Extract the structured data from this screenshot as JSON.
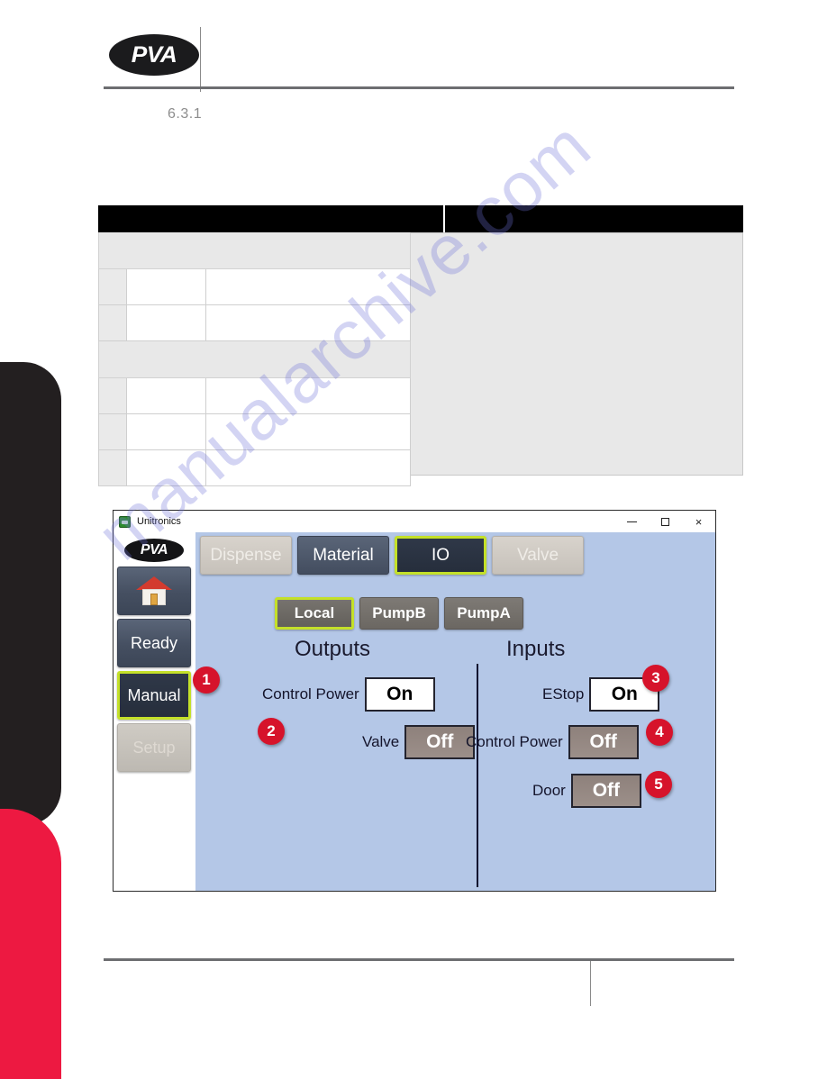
{
  "document": {
    "brand_logo_text": "PVA",
    "section_number": "6.3.1",
    "watermark": "manualarchive.com"
  },
  "table": {
    "header_left": "",
    "header_right": "",
    "group_rows": [
      "",
      ""
    ],
    "rows": [
      {
        "num": "",
        "name": "",
        "desc": ""
      },
      {
        "num": "",
        "name": "",
        "desc": ""
      },
      {
        "num": "",
        "name": "",
        "desc": ""
      },
      {
        "num": "",
        "name": "",
        "desc": ""
      },
      {
        "num": "",
        "name": "",
        "desc": ""
      }
    ]
  },
  "app": {
    "title": "Unitronics",
    "title_icon": "unitronics-icon",
    "window_controls": {
      "minimize": "minimize-icon",
      "maximize": "maximize-icon",
      "close": "×"
    },
    "logo_text": "PVA",
    "sidebar": {
      "home_icon": "house-icon",
      "items": [
        {
          "label": "Ready",
          "state": "normal"
        },
        {
          "label": "Manual",
          "state": "selected"
        },
        {
          "label": "Setup",
          "state": "disabled"
        }
      ]
    },
    "tabs": [
      {
        "label": "Dispense",
        "state": "inactive"
      },
      {
        "label": "Material",
        "state": "mid"
      },
      {
        "label": "IO",
        "state": "selected"
      },
      {
        "label": "Valve",
        "state": "inactive"
      }
    ],
    "subtabs": [
      {
        "label": "Local",
        "state": "selected"
      },
      {
        "label": "PumpB",
        "state": "normal"
      },
      {
        "label": "PumpA",
        "state": "normal"
      }
    ],
    "outputs": {
      "title": "Outputs",
      "rows": [
        {
          "label": "Control Power",
          "value": "On",
          "state": "on",
          "badge": "1"
        },
        {
          "label": "Valve",
          "value": "Off",
          "state": "off",
          "badge": "2"
        }
      ]
    },
    "inputs": {
      "title": "Inputs",
      "rows": [
        {
          "label": "EStop",
          "value": "On",
          "state": "on",
          "badge": "3"
        },
        {
          "label": "Control Power",
          "value": "Off",
          "state": "off",
          "badge": "4"
        },
        {
          "label": "Door",
          "value": "Off",
          "state": "off",
          "badge": "5"
        }
      ]
    }
  },
  "colors": {
    "accent_green": "#c4e029",
    "badge_red": "#d6132b",
    "app_background": "#b4c7e7",
    "edge_black": "#231f20",
    "edge_red": "#ed1941"
  }
}
